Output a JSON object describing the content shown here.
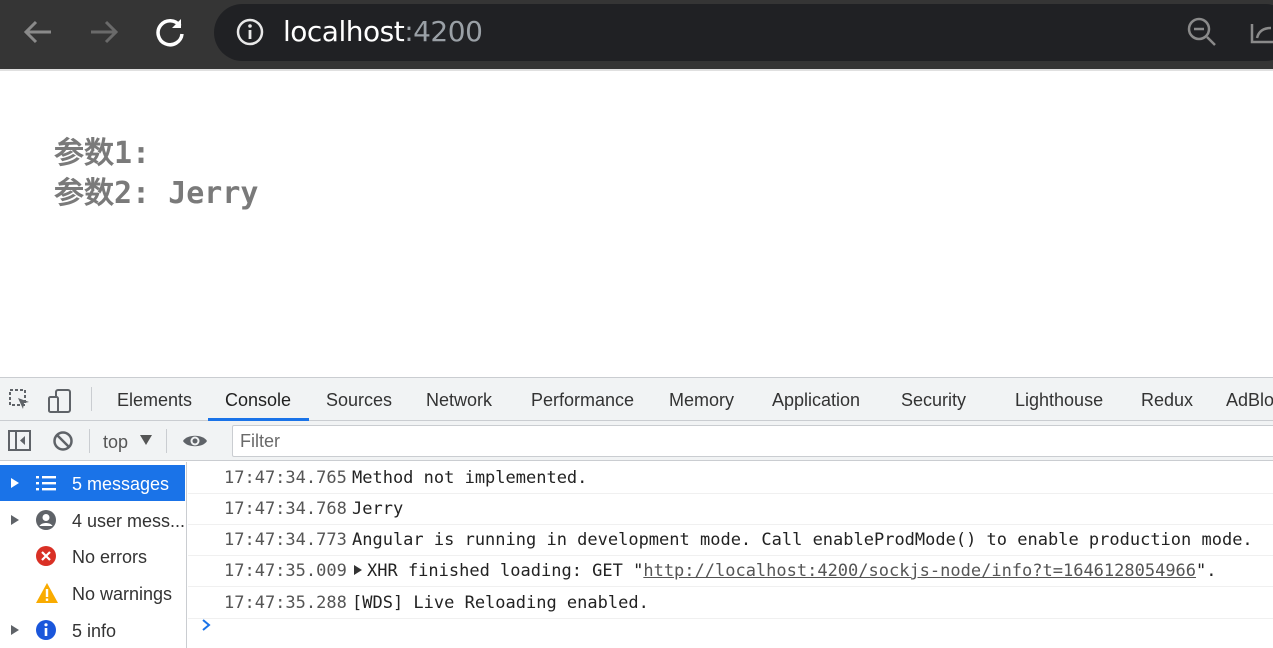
{
  "browser": {
    "url_host": "localhost",
    "url_port": ":4200"
  },
  "page": {
    "param1_label": "参数1:",
    "param1_value": "",
    "param2_label": "参数2:",
    "param2_value": "Jerry"
  },
  "devtools": {
    "tabs": [
      {
        "label": "Elements"
      },
      {
        "label": "Console"
      },
      {
        "label": "Sources"
      },
      {
        "label": "Network"
      },
      {
        "label": "Performance"
      },
      {
        "label": "Memory"
      },
      {
        "label": "Application"
      },
      {
        "label": "Security"
      },
      {
        "label": "Lighthouse"
      },
      {
        "label": "Redux"
      },
      {
        "label": "AdBlo"
      }
    ],
    "active_tab": "Console",
    "context": "top",
    "filter_placeholder": "Filter",
    "sidebar": [
      {
        "label": "5 messages",
        "icon": "list-icon"
      },
      {
        "label": "4 user mess...",
        "icon": "user-icon"
      },
      {
        "label": "No errors",
        "icon": "error-icon"
      },
      {
        "label": "No warnings",
        "icon": "warning-icon"
      },
      {
        "label": "5 info",
        "icon": "info-icon"
      }
    ],
    "logs": [
      {
        "time": "17:47:34.765",
        "message": "Method not implemented."
      },
      {
        "time": "17:47:34.768",
        "message": "Jerry"
      },
      {
        "time": "17:47:34.773",
        "message": "Angular is running in development mode. Call enableProdMode() to enable production mode."
      },
      {
        "time": "17:47:35.009",
        "message_prefix": "XHR finished loading: GET \"",
        "link": "http://localhost:4200/sockjs-node/info?t=1646128054966",
        "message_suffix": "\"."
      },
      {
        "time": "17:47:35.288",
        "message": "[WDS] Live Reloading enabled."
      }
    ]
  },
  "colors": {
    "accent": "#1a73e8",
    "topbar": "#353535",
    "omnibox": "#202124",
    "error": "#d93025",
    "warning": "#f9ab00"
  }
}
